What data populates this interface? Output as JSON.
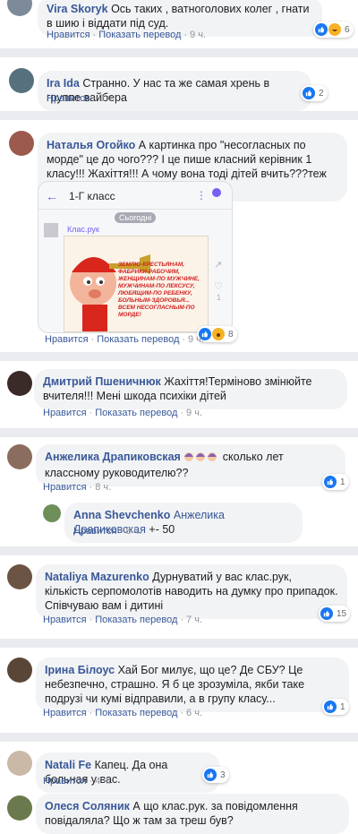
{
  "comments": [
    {
      "author": "Vira Skoryk",
      "text": "Ось таких , ватноголових колег , гнати в шию і віддати під суд.",
      "like": "Нравится",
      "translate": "Показать перевод",
      "time": "9 ч.",
      "count": "6"
    },
    {
      "author": "Ira Ida",
      "text": "Странно. У нас та же самая хрень в группе вайбера",
      "like": "Нравится",
      "time": "9 ч.",
      "count": "2"
    },
    {
      "author": "Наталья Огойко",
      "text": "А картинка про \"несогласных по морде\" це до чого??? І це пише класний керівник 1 класу!!! Жахіття!!! А чому вона тоді дітей вчить???теж по морді???",
      "like": "Нравится",
      "translate": "Показать перевод",
      "time": "9 ч.",
      "count": "8"
    },
    {
      "author": "Дмитрий Пшеничнюк",
      "text": "Жахіття!Терміново змінюйте вчителя!!! Мені шкода психіки дітей",
      "like": "Нравится",
      "translate": "Показать перевод",
      "time": "9 ч."
    },
    {
      "author": "Анжелика Драпиковская",
      "text": "сколько лет классному руководителю??",
      "like": "Нравится",
      "time": "8 ч.",
      "count": "1"
    },
    {
      "author": "Anna Shevchenko",
      "mention": "Анжелика Драпиковская",
      "text": "+- 50",
      "like": "Нравится",
      "time": "8 ч."
    },
    {
      "author": "Nataliya Mazurenko",
      "text": "Дурнуватий у вас клас.рук, кількість серпомолотів наводить на думку про припадок. Співчуваю вам і дитині",
      "like": "Нравится",
      "translate": "Показать перевод",
      "time": "7 ч.",
      "count": "15"
    },
    {
      "author": "Ірина Білоус",
      "text": "Хай Бог милує, що це? Де СБУ? Це небезпечно, страшно. Я б це зрозуміла, якби таке подрузі чи кумі відправили, а в групу класу...",
      "like": "Нравится",
      "translate": "Показать перевод",
      "time": "6 ч.",
      "count": "1"
    },
    {
      "author": "Natali Fe",
      "text": "Капец. Да она больная у вас.",
      "like": "Нравится",
      "time": "4 ч.",
      "count": "3"
    },
    {
      "author": "Олеся Соляник",
      "text": "А що клас.рук. за повідомлення повідаляла? Що ж там за треш був?"
    }
  ],
  "embedded": {
    "chat_title": "1-Г класс",
    "day_label": "Сьогодні",
    "sender": "Клас.рук",
    "poster_text": "ЗЕМЛЮ-КРЕСТЬЯНАМ, ФАБРИКИ-РАБОЧИМ, ЖЕНЩИНАМ-ПО МУЖЧИНЕ, МУЖЧИНАМ-ПО ЛЕКСУСУ, ЛЮБЯЩИМ-ПО РЕБЕНКУ, БОЛЬНЫМ-ЗДОРОВЬЯ... ВСЕМ НЕСОГЛАСНЫМ-ПО МОРДЕ!",
    "like_count": "1"
  },
  "colors": {
    "link": "#385898",
    "bubble": "#f2f3f5",
    "separator": "#e9ebee",
    "like": "#1877f2",
    "haha": "#f7b125",
    "viber": "#7360f2"
  }
}
